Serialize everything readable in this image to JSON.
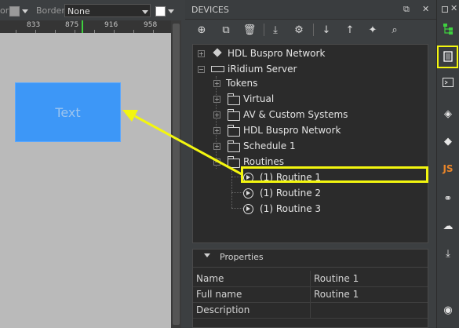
{
  "canvas_toolbar": {
    "partial_label": "or",
    "fill_swatch_color": "#9a9a9a",
    "border_label": "Border",
    "border_value": "None",
    "border_swatch_color": "#ffffff"
  },
  "ruler": {
    "ticks": [
      "833",
      "875",
      "916",
      "958"
    ]
  },
  "canvas": {
    "widget_text": "Text",
    "widget_color": "#3d97f7",
    "background": "#bababa"
  },
  "devices": {
    "title": "DEVICES",
    "header_buttons": [
      "restore-icon",
      "close-icon"
    ],
    "tools": [
      "add-icon",
      "duplicate-icon",
      "delete-icon",
      "import-icon",
      "device-settings-icon",
      "move-down-icon",
      "move-up-icon",
      "clean-icon",
      "search-icon"
    ],
    "tree": {
      "hdl_root": "HDL Buspro Network",
      "iridium_server": "iRidium Server",
      "tokens": "Tokens",
      "virtual": "Virtual",
      "av_custom": "AV & Custom Systems",
      "hdl_child": "HDL Buspro Network",
      "schedule": "Schedule 1",
      "routines": "Routines",
      "routine_items": [
        "(1) Routine 1",
        "(1) Routine 2",
        "(1) Routine 3"
      ]
    }
  },
  "properties": {
    "title": "Properties",
    "rows": [
      {
        "name": "Name",
        "value": "Routine 1"
      },
      {
        "name": "Full name",
        "value": "Routine 1"
      },
      {
        "name": "Description",
        "value": ""
      }
    ]
  },
  "right_toolbar": {
    "icons": [
      "project-tree-icon",
      "devices-icon",
      "terminal-icon",
      "gallery-icon",
      "styles-icon",
      "js-icon",
      "modules-icon",
      "cloud-icon",
      "download-icon",
      "camera-icon"
    ],
    "js_label": "JS",
    "highlight_color": "#f3f60f"
  }
}
